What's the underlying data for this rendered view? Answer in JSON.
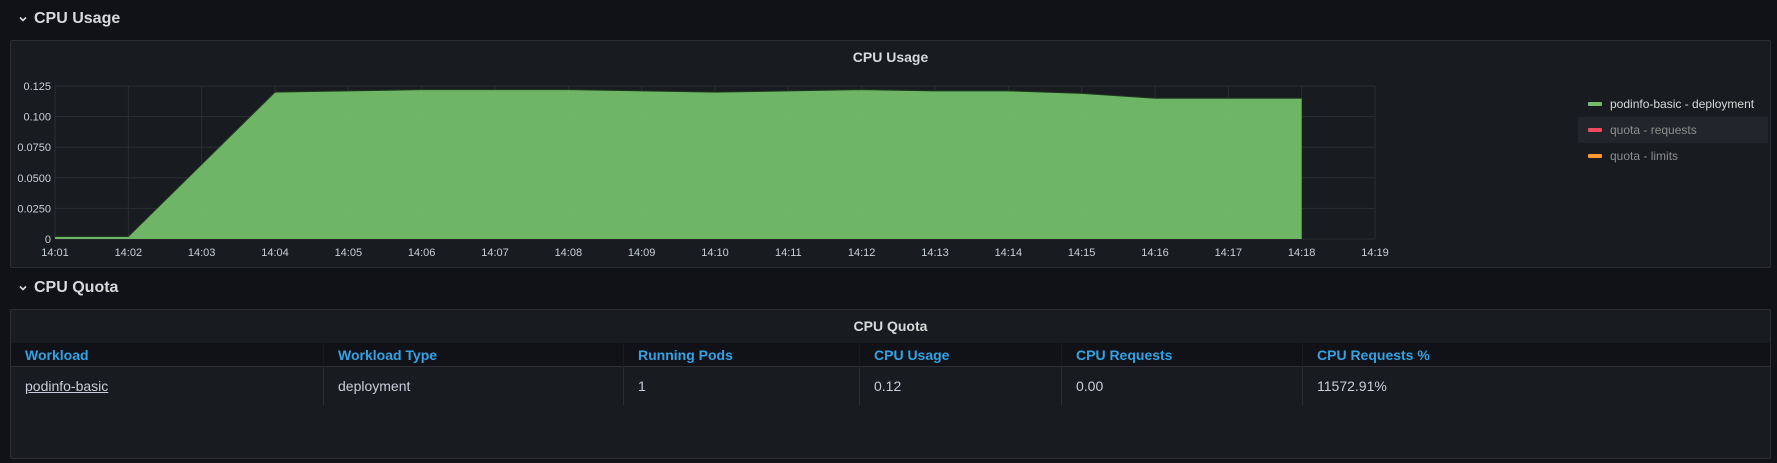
{
  "rows": {
    "cpu_usage": "CPU Usage",
    "cpu_quota": "CPU Quota"
  },
  "usage_panel": {
    "title": "CPU Usage"
  },
  "quota_panel": {
    "title": "CPU Quota"
  },
  "legend": [
    {
      "label": "podinfo-basic - deployment",
      "color": "#73bf69"
    },
    {
      "label": "quota - requests",
      "color": "#f2495c"
    },
    {
      "label": "quota - limits",
      "color": "#ff9830"
    }
  ],
  "chart_data": {
    "type": "area",
    "title": "CPU Usage",
    "x_ticks": [
      "14:01",
      "14:02",
      "14:03",
      "14:04",
      "14:05",
      "14:06",
      "14:07",
      "14:08",
      "14:09",
      "14:10",
      "14:11",
      "14:12",
      "14:13",
      "14:14",
      "14:15",
      "14:16",
      "14:17",
      "14:18",
      "14:19"
    ],
    "y_ticks": [
      "0",
      "0.0250",
      "0.0500",
      "0.0750",
      "0.100",
      "0.125"
    ],
    "ylim": [
      0,
      0.125
    ],
    "grid": true,
    "legend_position": "right",
    "series": [
      {
        "name": "podinfo-basic - deployment",
        "color": "#73bf69",
        "x": [
          "14:01",
          "14:02",
          "14:04",
          "14:05",
          "14:06",
          "14:07",
          "14:08",
          "14:09",
          "14:10",
          "14:11",
          "14:12",
          "14:13",
          "14:14",
          "14:15",
          "14:16",
          "14:17",
          "14:18"
        ],
        "values": [
          0.002,
          0.002,
          0.12,
          0.121,
          0.122,
          0.122,
          0.122,
          0.121,
          0.12,
          0.121,
          0.122,
          0.121,
          0.121,
          0.119,
          0.115,
          0.115,
          0.115
        ]
      }
    ]
  },
  "table": {
    "columns": [
      "Workload",
      "Workload Type",
      "Running Pods",
      "CPU Usage",
      "CPU Requests",
      "CPU Requests %"
    ],
    "rows": [
      [
        "podinfo-basic",
        "deployment",
        "1",
        "0.12",
        "0.00",
        "11572.91%"
      ]
    ]
  }
}
